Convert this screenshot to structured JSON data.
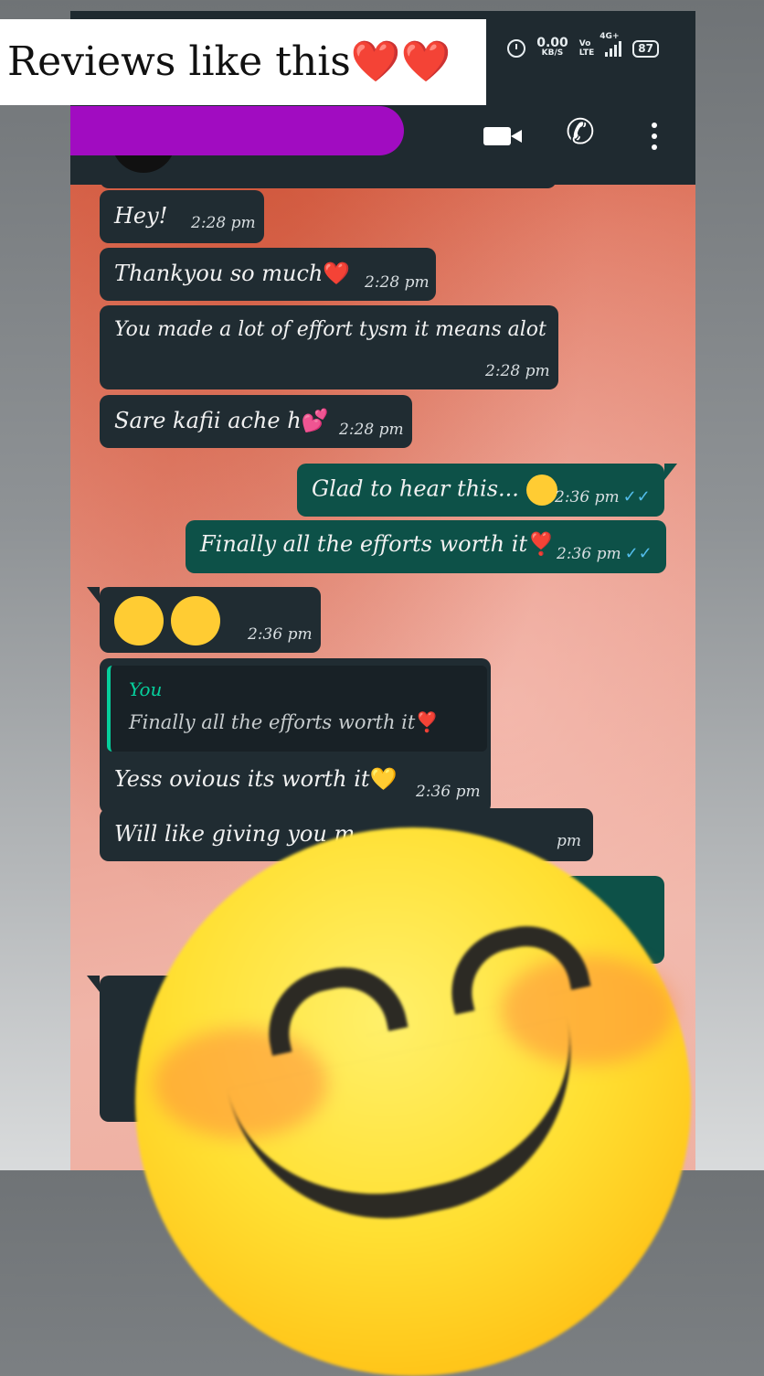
{
  "status_bar": {
    "speed_value": "0.00",
    "speed_unit": "KB/S",
    "volte_top": "Vo",
    "volte_bottom": "LTE",
    "network": "4G+",
    "battery": "87"
  },
  "messages": [
    {
      "text": "Hey!",
      "time": "2:28 pm",
      "direction": "in"
    },
    {
      "text": "Thankyou so much",
      "emoji": "❤️",
      "time": "2:28 pm",
      "direction": "in"
    },
    {
      "text": "You made a lot of effort tysm it means alot",
      "time": "2:28 pm",
      "direction": "in"
    },
    {
      "text": "Sare kafii ache h",
      "emoji": "💕",
      "time": "2:28 pm",
      "direction": "in"
    },
    {
      "text": "Glad to hear this...",
      "emoji": "😊",
      "time": "2:36 pm",
      "direction": "out",
      "status": "read"
    },
    {
      "text": "Finally all the efforts worth it",
      "emoji": "❣️",
      "time": "2:36 pm",
      "direction": "out",
      "status": "read"
    },
    {
      "text": "",
      "emoji": "😊😊",
      "time": "2:36 pm",
      "direction": "in"
    },
    {
      "quote_author": "You",
      "quote_text": "Finally all the efforts worth it",
      "quote_emoji": "❣️",
      "text": "Yess ovious its worth it",
      "emoji": "💛",
      "time": "2:36 pm",
      "direction": "in"
    },
    {
      "text": "Will like giving you m",
      "time": "pm",
      "direction": "in"
    }
  ],
  "overlay": {
    "caption": "Reviews like this",
    "hearts": "❤️❤️"
  },
  "colors": {
    "header_bg": "#1f2a30",
    "incoming_bubble": "#202c32",
    "outgoing_bubble": "#0d5148",
    "read_ticks": "#53bdeb",
    "redaction": "#a10cc1"
  }
}
